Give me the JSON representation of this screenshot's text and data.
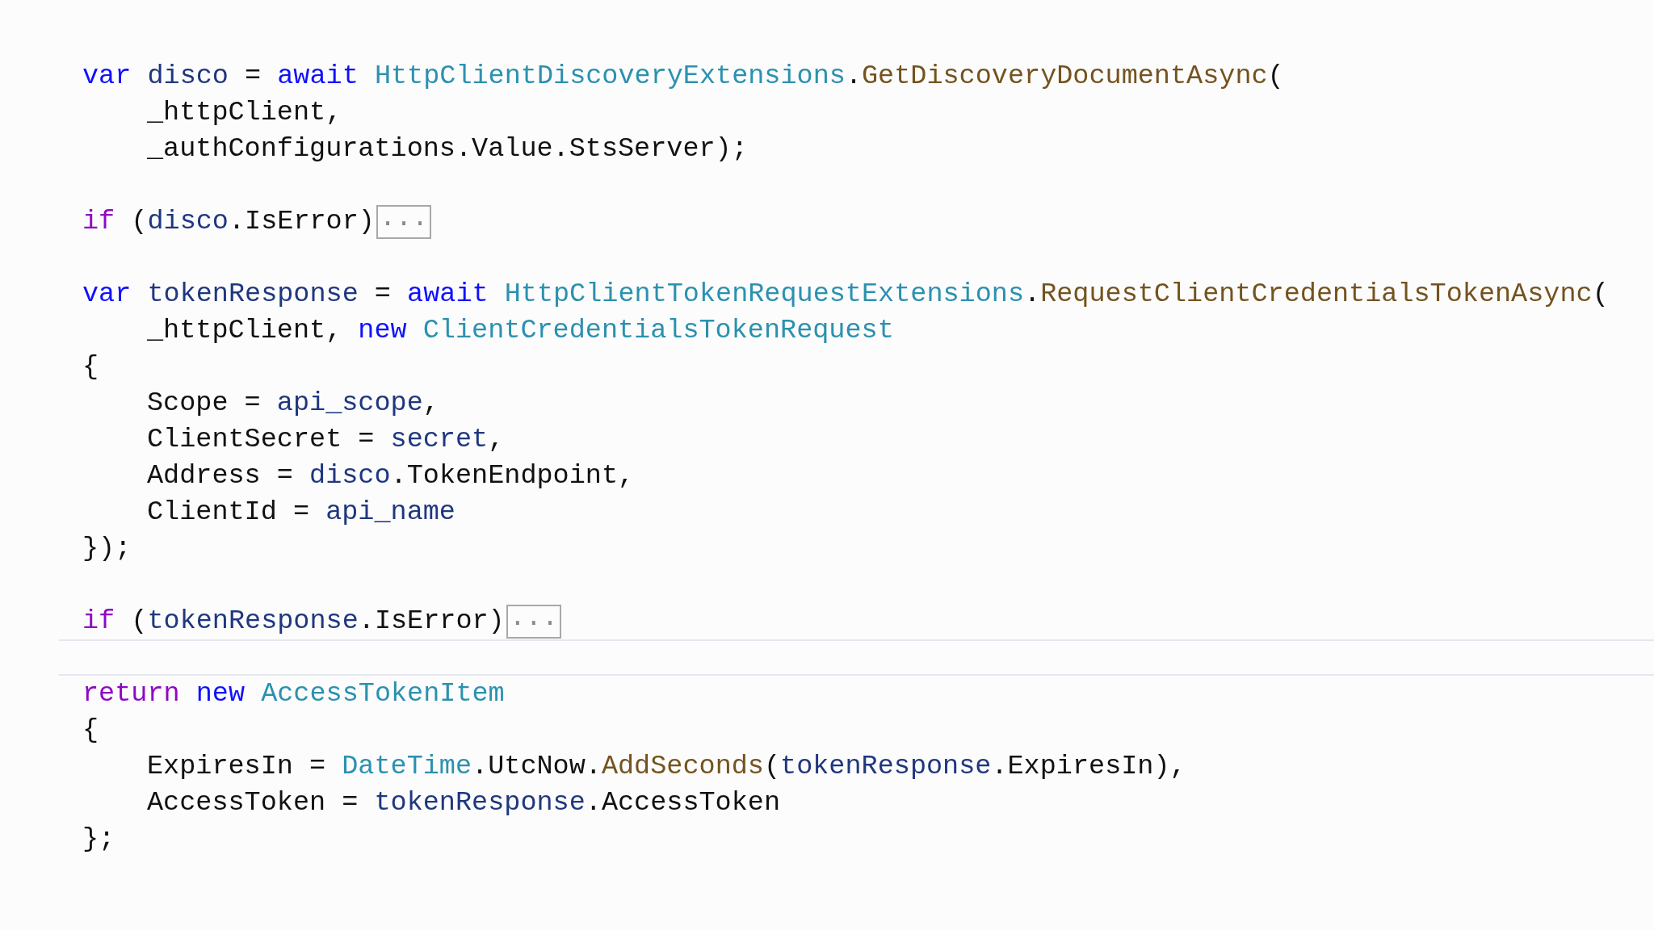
{
  "editor": {
    "lines": [
      {
        "kind": "code",
        "tokens": [
          {
            "text": "var ",
            "kind": "keyword"
          },
          {
            "text": "disco",
            "kind": "local"
          },
          {
            "text": " = "
          },
          {
            "text": "await ",
            "kind": "keyword"
          },
          {
            "text": "HttpClientDiscoveryExtensions",
            "kind": "type"
          },
          {
            "text": "."
          },
          {
            "text": "GetDiscoveryDocumentAsync",
            "kind": "method"
          },
          {
            "text": "("
          }
        ]
      },
      {
        "kind": "indented",
        "tokens": [
          {
            "text": "_httpClient,"
          }
        ]
      },
      {
        "kind": "indented",
        "tokens": [
          {
            "text": "_authConfigurations.Value.StsServer);"
          }
        ]
      },
      {
        "kind": "blank"
      },
      {
        "kind": "code",
        "tokens": [
          {
            "text": "if",
            "kind": "control"
          },
          {
            "text": " ("
          },
          {
            "text": "disco",
            "kind": "local"
          },
          {
            "text": ".IsError)"
          }
        ],
        "collapsed": "..."
      },
      {
        "kind": "blank"
      },
      {
        "kind": "code",
        "tokens": [
          {
            "text": "var ",
            "kind": "keyword"
          },
          {
            "text": "tokenResponse",
            "kind": "local"
          },
          {
            "text": " = "
          },
          {
            "text": "await ",
            "kind": "keyword"
          },
          {
            "text": "HttpClientTokenRequestExtensions",
            "kind": "type"
          },
          {
            "text": "."
          },
          {
            "text": "RequestClientCredentialsTokenAsync",
            "kind": "method"
          },
          {
            "text": "("
          }
        ]
      },
      {
        "kind": "indented",
        "tokens": [
          {
            "text": "_httpClient, "
          },
          {
            "text": "new ",
            "kind": "keyword"
          },
          {
            "text": "ClientCredentialsTokenRequest",
            "kind": "type"
          }
        ]
      },
      {
        "kind": "code",
        "tokens": [
          {
            "text": "{"
          }
        ]
      },
      {
        "kind": "indented",
        "tokens": [
          {
            "text": "Scope = "
          },
          {
            "text": "api_scope",
            "kind": "local"
          },
          {
            "text": ","
          }
        ]
      },
      {
        "kind": "indented",
        "tokens": [
          {
            "text": "ClientSecret = "
          },
          {
            "text": "secret",
            "kind": "local"
          },
          {
            "text": ","
          }
        ]
      },
      {
        "kind": "indented",
        "tokens": [
          {
            "text": "Address = "
          },
          {
            "text": "disco",
            "kind": "local"
          },
          {
            "text": ".TokenEndpoint,"
          }
        ]
      },
      {
        "kind": "indented",
        "tokens": [
          {
            "text": "ClientId = "
          },
          {
            "text": "api_name",
            "kind": "local"
          }
        ]
      },
      {
        "kind": "code",
        "tokens": [
          {
            "text": "});"
          }
        ]
      },
      {
        "kind": "blank"
      },
      {
        "kind": "code",
        "tokens": [
          {
            "text": "if",
            "kind": "control"
          },
          {
            "text": " ("
          },
          {
            "text": "tokenResponse",
            "kind": "local"
          },
          {
            "text": ".IsError)"
          }
        ],
        "collapsed": "..."
      },
      {
        "kind": "current-blank"
      },
      {
        "kind": "code",
        "tokens": [
          {
            "text": "return ",
            "kind": "control"
          },
          {
            "text": "new ",
            "kind": "keyword"
          },
          {
            "text": "AccessTokenItem",
            "kind": "type"
          }
        ]
      },
      {
        "kind": "code",
        "tokens": [
          {
            "text": "{"
          }
        ]
      },
      {
        "kind": "indented",
        "tokens": [
          {
            "text": "ExpiresIn = "
          },
          {
            "text": "DateTime",
            "kind": "type"
          },
          {
            "text": ".UtcNow."
          },
          {
            "text": "AddSeconds",
            "kind": "method"
          },
          {
            "text": "("
          },
          {
            "text": "tokenResponse",
            "kind": "local"
          },
          {
            "text": ".ExpiresIn),"
          }
        ]
      },
      {
        "kind": "indented",
        "tokens": [
          {
            "text": "AccessToken = "
          },
          {
            "text": "tokenResponse",
            "kind": "local"
          },
          {
            "text": ".AccessToken"
          }
        ]
      },
      {
        "kind": "code",
        "tokens": [
          {
            "text": "};"
          }
        ]
      }
    ]
  }
}
